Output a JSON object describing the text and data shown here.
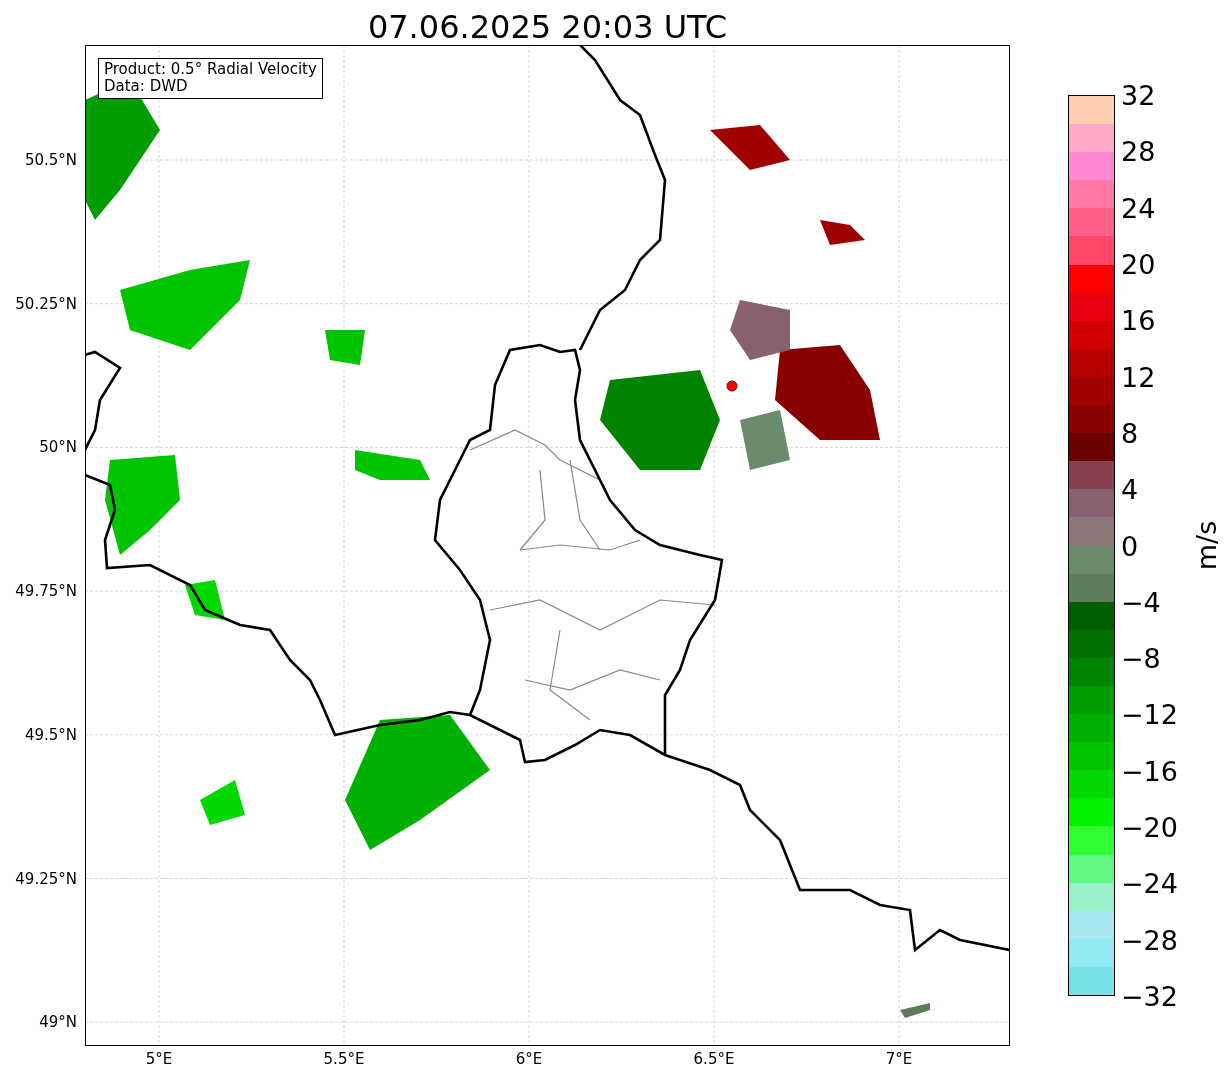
{
  "title": "07.06.2025 20:03 UTC",
  "legend": [
    "Product: 0.5° Radial Velocity",
    "Data: DWD"
  ],
  "map": {
    "xticks": [
      "5°E",
      "5.5°E",
      "6°E",
      "6.5°E",
      "7°E"
    ],
    "yticks": [
      "50.5°N",
      "50.25°N",
      "50°N",
      "49.75°N",
      "49.5°N",
      "49.25°N",
      "49°N"
    ]
  },
  "colorbar": {
    "label": "m/s",
    "ticks": [
      "32",
      "28",
      "24",
      "20",
      "16",
      "12",
      "8",
      "4",
      "0",
      "−4",
      "−8",
      "−12",
      "−16",
      "−20",
      "−24",
      "−28",
      "−32"
    ],
    "bands": [
      {
        "color": "#ffd0b0"
      },
      {
        "color": "#ffa8c8"
      },
      {
        "color": "#ff88d0"
      },
      {
        "color": "#ff78a8"
      },
      {
        "color": "#ff6088"
      },
      {
        "color": "#ff4868"
      },
      {
        "color": "#ff0000"
      },
      {
        "color": "#e80010"
      },
      {
        "color": "#d00000"
      },
      {
        "color": "#b80000"
      },
      {
        "color": "#a00000"
      },
      {
        "color": "#880000"
      },
      {
        "color": "#6c0000"
      },
      {
        "color": "#884050"
      },
      {
        "color": "#886070"
      },
      {
        "color": "#8c7878"
      },
      {
        "color": "#6c8a6c"
      },
      {
        "color": "#5c7c5c"
      },
      {
        "color": "#006000"
      },
      {
        "color": "#007000"
      },
      {
        "color": "#008400"
      },
      {
        "color": "#009c00"
      },
      {
        "color": "#00b000"
      },
      {
        "color": "#00c400"
      },
      {
        "color": "#00d800"
      },
      {
        "color": "#00f000"
      },
      {
        "color": "#30ff30"
      },
      {
        "color": "#60f880"
      },
      {
        "color": "#98f0c8"
      },
      {
        "color": "#a8e8f0"
      },
      {
        "color": "#90e8f0"
      },
      {
        "color": "#78e0e8"
      }
    ]
  }
}
